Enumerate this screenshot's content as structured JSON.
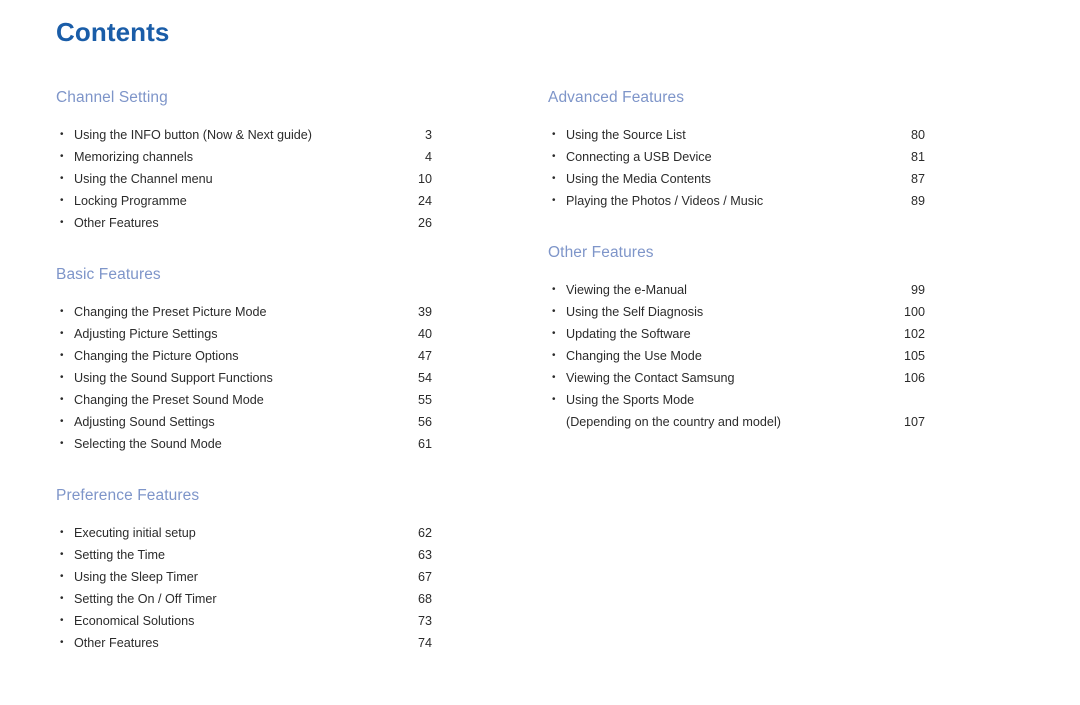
{
  "document": {
    "title": "Contents",
    "bullet_glyph": "•",
    "colors": {
      "title": "#1a5da8",
      "section_header": "#7e95c9",
      "body_text": "#2b2b2b",
      "background": "#ffffff"
    }
  },
  "columns": {
    "left": [
      {
        "header": "Channel Setting",
        "items": [
          {
            "label": "Using the INFO button (Now & Next guide)",
            "page": "3"
          },
          {
            "label": "Memorizing channels",
            "page": "4"
          },
          {
            "label": "Using the Channel menu",
            "page": "10"
          },
          {
            "label": "Locking Programme",
            "page": "24"
          },
          {
            "label": "Other Features",
            "page": "26"
          }
        ]
      },
      {
        "header": "Basic Features",
        "items": [
          {
            "label": "Changing the Preset Picture Mode",
            "page": "39"
          },
          {
            "label": "Adjusting Picture Settings",
            "page": "40"
          },
          {
            "label": "Changing the Picture Options",
            "page": "47"
          },
          {
            "label": "Using the Sound Support Functions",
            "page": "54"
          },
          {
            "label": "Changing the Preset Sound Mode",
            "page": "55"
          },
          {
            "label": "Adjusting Sound Settings",
            "page": "56"
          },
          {
            "label": "Selecting the Sound Mode",
            "page": "61"
          }
        ]
      },
      {
        "header": "Preference Features",
        "items": [
          {
            "label": "Executing initial setup",
            "page": "62"
          },
          {
            "label": "Setting the Time",
            "page": "63"
          },
          {
            "label": "Using the Sleep Timer",
            "page": "67"
          },
          {
            "label": "Setting the On / Off Timer",
            "page": "68"
          },
          {
            "label": "Economical Solutions",
            "page": "73"
          },
          {
            "label": "Other Features",
            "page": "74"
          }
        ]
      }
    ],
    "right": [
      {
        "header": "Advanced Features",
        "items": [
          {
            "label": "Using the Source List",
            "page": "80"
          },
          {
            "label": "Connecting a USB Device",
            "page": "81"
          },
          {
            "label": "Using the Media Contents",
            "page": "87"
          },
          {
            "label": "Playing the Photos / Videos / Music",
            "page": "89"
          }
        ]
      },
      {
        "header": "Other Features",
        "items": [
          {
            "label": "Viewing the e-Manual",
            "page": "99"
          },
          {
            "label": "Using the Self Diagnosis",
            "page": "100"
          },
          {
            "label": "Updating the Software",
            "page": "102"
          },
          {
            "label": "Changing the Use Mode",
            "page": "105"
          },
          {
            "label": "Viewing the Contact Samsung",
            "page": "106"
          },
          {
            "label": "Using the Sports Mode\n(Depending on the country and model)",
            "page": "107"
          }
        ]
      }
    ]
  }
}
